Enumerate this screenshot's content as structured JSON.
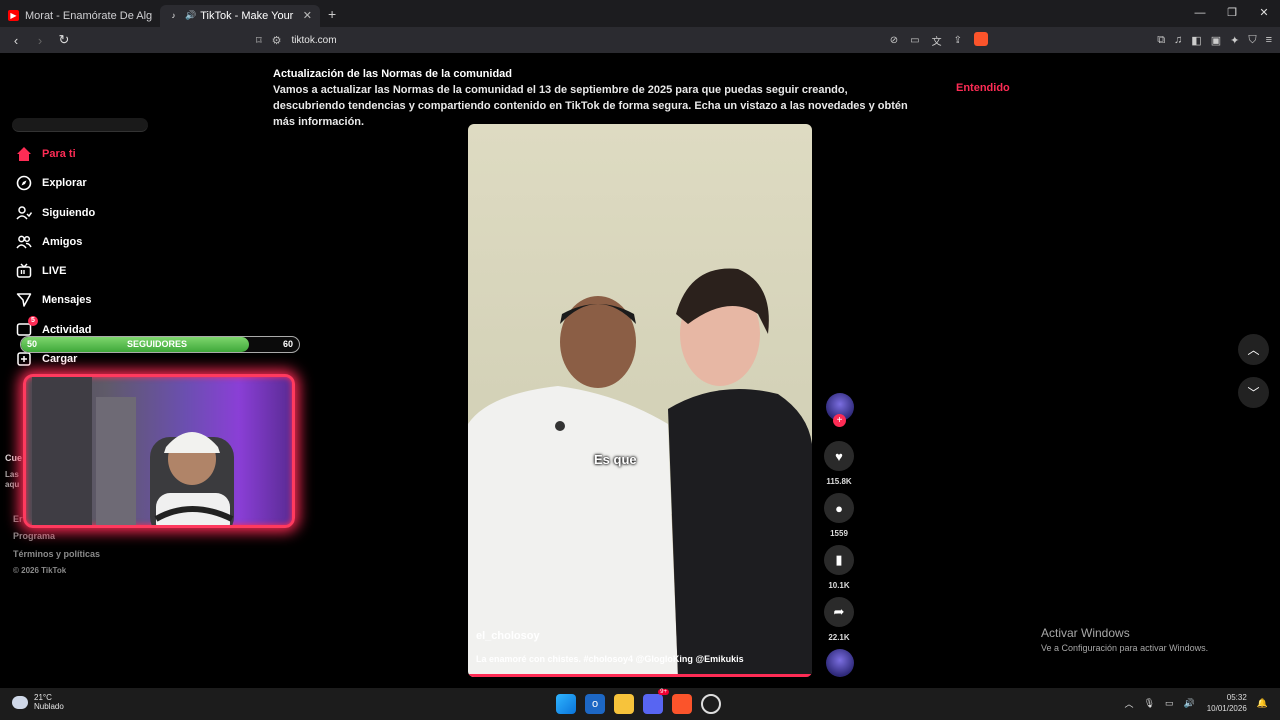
{
  "tabs": [
    {
      "title": "Morat - Enamórate De Alguien Más (",
      "active": false
    },
    {
      "title": "TikTok - Make Your Day",
      "active": true
    }
  ],
  "url": "tiktok.com",
  "notice": {
    "title": "Actualización de las Normas de la comunidad",
    "body": "Vamos a actualizar las Normas de la comunidad el 13 de septiembre de 2025 para que puedas seguir creando, descubriendo tendencias y compartiendo contenido en TikTok de forma segura. Echa un vistazo a las novedades y obtén más información.",
    "action": "Entendido"
  },
  "sidebar": {
    "items": [
      {
        "label": "Para ti",
        "icon": "home-icon"
      },
      {
        "label": "Explorar",
        "icon": "compass-icon"
      },
      {
        "label": "Siguiendo",
        "icon": "following-icon"
      },
      {
        "label": "Amigos",
        "icon": "friends-icon"
      },
      {
        "label": "LIVE",
        "icon": "live-icon"
      },
      {
        "label": "Mensajes",
        "icon": "messages-icon"
      },
      {
        "label": "Actividad",
        "icon": "activity-icon",
        "badge": "5"
      },
      {
        "label": "Cargar",
        "icon": "upload-icon"
      }
    ],
    "partial_left": [
      "Cue",
      "Las",
      "aqu",
      "Er"
    ],
    "footer": [
      "Programa",
      "Términos y políticas",
      "© 2026 TikTok"
    ]
  },
  "followers_bar": {
    "min": "50",
    "label": "SEGUIDORES",
    "max": "60",
    "progress": 0.82
  },
  "video": {
    "author": "el_cholosoy",
    "caption": "La enamoré con chistes. #cholosoy4 @GlogloKing @Emikukis",
    "subtitle": "Es que"
  },
  "actions": {
    "likes": "115.8K",
    "comments": "1559",
    "saves": "10.1K",
    "shares": "22.1K"
  },
  "watermark": {
    "line1": "Activar Windows",
    "line2": "Ve a Configuración para activar Windows."
  },
  "taskbar": {
    "temp": "21°C",
    "weather": "Nublado",
    "time": "05:32",
    "date": "10/01/2026",
    "discord_badge": "9+"
  }
}
